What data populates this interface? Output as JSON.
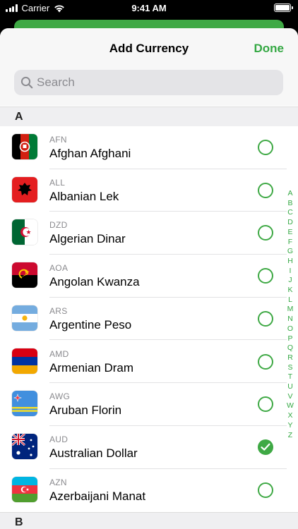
{
  "status_bar": {
    "carrier": "Carrier",
    "time": "9:41 AM"
  },
  "nav": {
    "title": "Add Currency",
    "done_label": "Done"
  },
  "search": {
    "placeholder": "Search"
  },
  "sections": {
    "a": "A",
    "b": "B"
  },
  "colors": {
    "accent": "#3fa945",
    "sheet_bg": "#ffffff",
    "header_bg": "#f7f7f7"
  },
  "currencies": [
    {
      "code": "AFN",
      "name": "Afghan Afghani",
      "flag": "afghanistan-flag-icon",
      "selected": false
    },
    {
      "code": "ALL",
      "name": "Albanian Lek",
      "flag": "albania-flag-icon",
      "selected": false
    },
    {
      "code": "DZD",
      "name": "Algerian Dinar",
      "flag": "algeria-flag-icon",
      "selected": false
    },
    {
      "code": "AOA",
      "name": "Angolan Kwanza",
      "flag": "angola-flag-icon",
      "selected": false
    },
    {
      "code": "ARS",
      "name": "Argentine Peso",
      "flag": "argentina-flag-icon",
      "selected": false
    },
    {
      "code": "AMD",
      "name": "Armenian Dram",
      "flag": "armenia-flag-icon",
      "selected": false
    },
    {
      "code": "AWG",
      "name": "Aruban Florin",
      "flag": "aruba-flag-icon",
      "selected": false
    },
    {
      "code": "AUD",
      "name": "Australian Dollar",
      "flag": "australia-flag-icon",
      "selected": true
    },
    {
      "code": "AZN",
      "name": "Azerbaijani Manat",
      "flag": "azerbaijan-flag-icon",
      "selected": false
    }
  ],
  "index_letters": [
    "A",
    "B",
    "C",
    "D",
    "E",
    "F",
    "G",
    "H",
    "I",
    "J",
    "K",
    "L",
    "M",
    "N",
    "O",
    "P",
    "Q",
    "R",
    "S",
    "T",
    "U",
    "V",
    "W",
    "X",
    "Y",
    "Z"
  ]
}
